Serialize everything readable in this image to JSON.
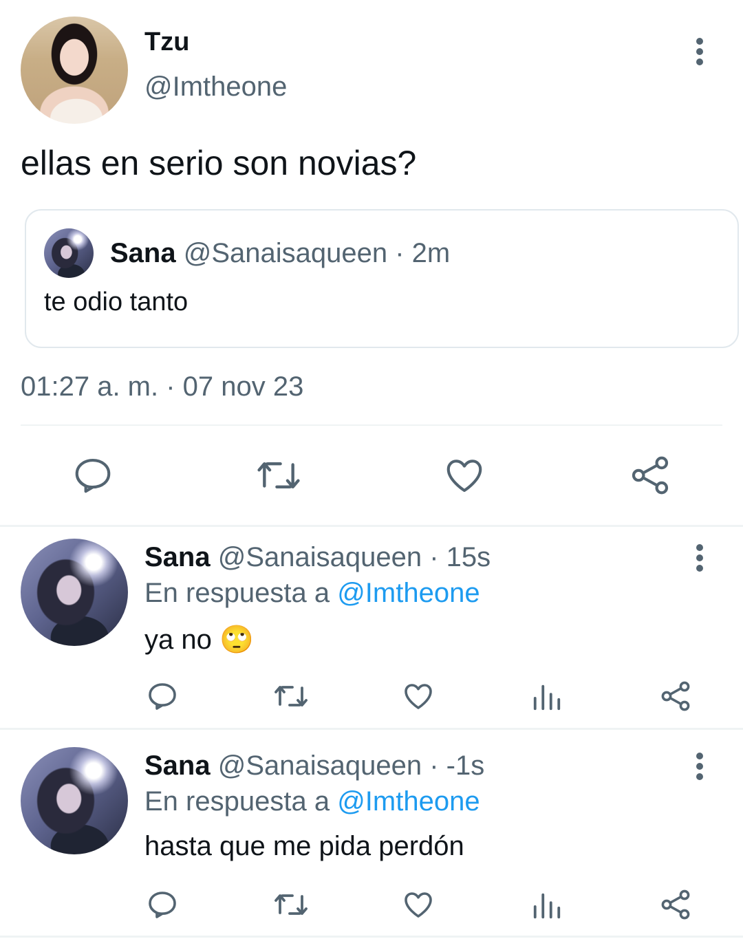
{
  "main_tweet": {
    "author_name": "Tzu",
    "author_handle": "@Imtheone",
    "text": "ellas en serio son novias?",
    "quoted": {
      "author_name": "Sana",
      "author_handle": "@Sanaisaqueen",
      "time": "· 2m",
      "text": "te odio tanto"
    },
    "timestamp": "01:27 a. m. · 07 nov 23"
  },
  "replies": [
    {
      "author_name": "Sana",
      "author_handle": "@Sanaisaqueen",
      "time": "· 15s",
      "reply_prefix": "En respuesta a",
      "reply_to": "@Imtheone",
      "text": "ya no",
      "emoji": "🙄"
    },
    {
      "author_name": "Sana",
      "author_handle": "@Sanaisaqueen",
      "time": "· -1s",
      "reply_prefix": "En respuesta a",
      "reply_to": "@Imtheone",
      "text": "hasta que me pida perdón"
    }
  ],
  "icons": {
    "reply": "reply-bubble-icon",
    "retweet": "retweet-icon",
    "like": "heart-icon",
    "views": "views-chart-icon",
    "share": "share-icon",
    "more": "more-vertical-icon"
  },
  "colors": {
    "text": "#0f1419",
    "muted": "#536471",
    "link": "#1d9bf0",
    "divider": "#eff3f4"
  }
}
